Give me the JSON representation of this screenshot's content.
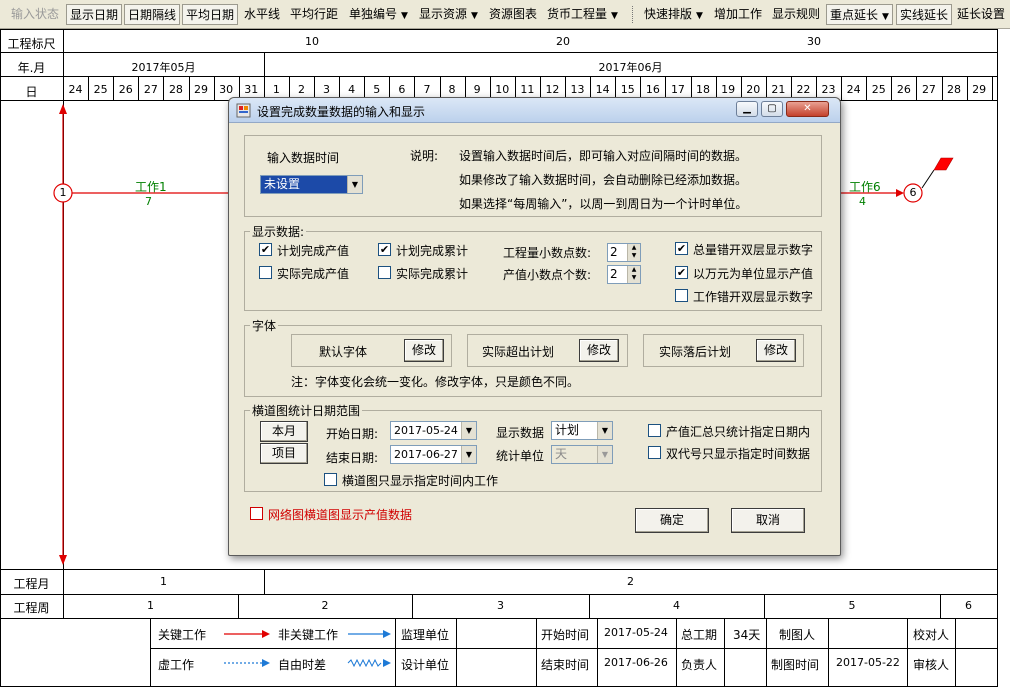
{
  "toolbar": {
    "items": [
      "输入状态",
      "显示日期",
      "日期隔线",
      "平均日期",
      "水平线",
      "平均行距",
      "单独编号",
      "显示资源",
      "资源图表",
      "货币工程量",
      "快速排版",
      "增加工作",
      "显示规则",
      "重点延长",
      "实线延长",
      "延长设置"
    ]
  },
  "gantt": {
    "row_labels": {
      "scale": "工程标尺",
      "month": "年.月",
      "day": "日",
      "proj_month": "工程月",
      "proj_week": "工程周"
    },
    "scale_ticks": [
      "10",
      "20",
      "30"
    ],
    "months": [
      "2017年05月",
      "2017年06月"
    ],
    "days": [
      "24",
      "25",
      "26",
      "27",
      "28",
      "29",
      "30",
      "31",
      "1",
      "2",
      "3",
      "4",
      "5",
      "6",
      "7",
      "8",
      "9",
      "10",
      "11",
      "12",
      "13",
      "14",
      "15",
      "16",
      "17",
      "18",
      "19",
      "20",
      "21",
      "22",
      "23",
      "24",
      "25",
      "26",
      "27",
      "28",
      "29"
    ],
    "proj_months": [
      "1",
      "2"
    ],
    "proj_weeks": [
      "1",
      "2",
      "3",
      "4",
      "5",
      "6"
    ],
    "nodes": [
      "1",
      "6"
    ],
    "tasks": [
      {
        "name": "工作1",
        "duration": "7"
      },
      {
        "name": "工作6",
        "duration": "4"
      }
    ]
  },
  "legend": {
    "critical": "关键工作",
    "noncritical": "非关键工作",
    "virtual": "虚工作",
    "float": "自由时差",
    "supervisor": "监理单位",
    "designer": "设计单位",
    "start_label": "开始时间",
    "start_value": "2017-05-24",
    "end_label": "结束时间",
    "end_value": "2017-06-26",
    "duration_label": "总工期",
    "duration_value": "34天",
    "responsible": "负责人",
    "drafter": "制图人",
    "draw_time_label": "制图时间",
    "draw_time_value": "2017-05-22",
    "checker": "校对人",
    "reviewer": "审核人"
  },
  "dialog": {
    "title": "设置完成数量数据的输入和显示",
    "input_time_label": "输入数据时间",
    "input_time_value": "未设置",
    "note_label": "说明:",
    "note_lines": [
      "设置输入数据时间后，即可输入对应间隔时间的数据。",
      "如果修改了输入数据时间，会自动删除已经添加数据。",
      "如果选择“每周输入”，以周一到周日为一个计时单位。"
    ],
    "display": {
      "legend": "显示数据:",
      "plan_output": "计划完成产值",
      "plan_cumulative": "计划完成累计",
      "actual_output": "实际完成产值",
      "actual_cumulative": "实际完成累计",
      "qty_decimals_label": "工程量小数点数:",
      "qty_decimals": "2",
      "value_decimals_label": "产值小数点个数:",
      "value_decimals": "2",
      "total_split": "总量错开双层显示数字",
      "wan_unit": "以万元为单位显示产值",
      "work_split": "工作错开双层显示数字"
    },
    "font": {
      "legend": "字体",
      "default": "默认字体",
      "over_plan": "实际超出计划",
      "behind_plan": "实际落后计划",
      "modify": "修改",
      "note": "注：字体变化会统一变化。修改字体，只是颜色不同。"
    },
    "range": {
      "legend": "横道图统计日期范围",
      "this_month": "本月",
      "project": "项目",
      "start_label": "开始日期:",
      "start_date": "2017-05-24",
      "end_label": "结束日期:",
      "end_date": "2017-06-27",
      "show_data_label": "显示数据",
      "show_data_value": "计划",
      "stat_unit_label": "统计单位",
      "stat_unit_value": "天",
      "sum_in_range": "产值汇总只统计指定日期内",
      "dual_code": "双代号只显示指定时间数据",
      "only_range": "横道图只显示指定时间内工作"
    },
    "network_show": "网络图横道图显示产值数据",
    "ok": "确定",
    "cancel": "取消"
  }
}
